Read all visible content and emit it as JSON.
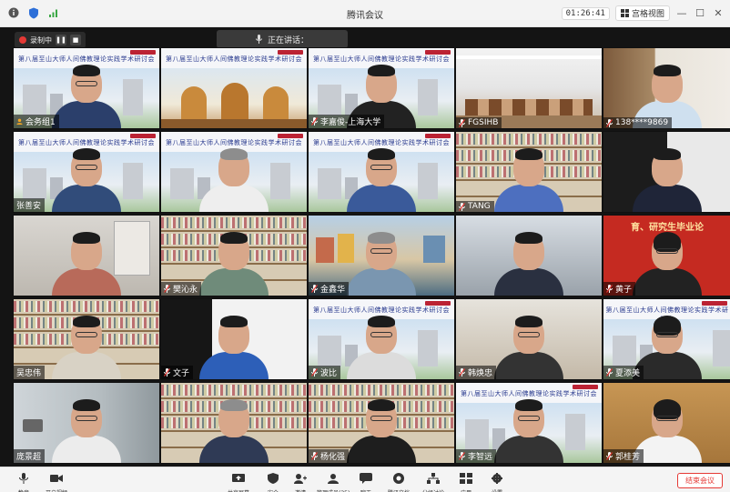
{
  "window": {
    "title": "腾讯会议",
    "timer": "01:26:41",
    "view_label": "宫格视图"
  },
  "recording": {
    "label": "录制中"
  },
  "speaking": {
    "label": "正在讲话："
  },
  "participants": [
    {
      "name": "会务组1",
      "icon": "user-host-icon"
    },
    {
      "name": "",
      "icon": ""
    },
    {
      "name": "李嘉俊-上海大学",
      "icon": "mic-muted-icon"
    },
    {
      "name": "FGSIHB",
      "icon": "mic-muted-icon"
    },
    {
      "name": "138****9869",
      "icon": "mic-muted-icon"
    },
    {
      "name": "张善安",
      "icon": ""
    },
    {
      "name": "",
      "icon": ""
    },
    {
      "name": "",
      "icon": ""
    },
    {
      "name": "TANG",
      "icon": "mic-muted-icon"
    },
    {
      "name": "",
      "icon": ""
    },
    {
      "name": "",
      "icon": ""
    },
    {
      "name": "樊沁永",
      "icon": "mic-muted-icon"
    },
    {
      "name": "金鑫华",
      "icon": "mic-muted-icon"
    },
    {
      "name": "",
      "icon": ""
    },
    {
      "name": "黄子",
      "icon": "mic-muted-icon"
    },
    {
      "name": "吴忠伟",
      "icon": ""
    },
    {
      "name": "文子",
      "icon": "mic-muted-icon"
    },
    {
      "name": "波比",
      "icon": "mic-muted-icon"
    },
    {
      "name": "韩焕忠",
      "icon": "mic-muted-icon"
    },
    {
      "name": "夏添美",
      "icon": "mic-muted-icon"
    },
    {
      "name": "庞景超",
      "icon": ""
    },
    {
      "name": "",
      "icon": ""
    },
    {
      "name": "杨化强",
      "icon": "mic-muted-icon"
    },
    {
      "name": "李智远",
      "icon": "mic-muted-icon"
    },
    {
      "name": "郭桂芳",
      "icon": "mic-muted-icon"
    }
  ],
  "banner_text": "第八届至山大师人间佛教理论实践学术研讨会",
  "secondary_banner": "育、研究生毕业论",
  "toolbar": {
    "items": [
      {
        "label": "静音",
        "icon": "microphone-icon"
      },
      {
        "label": "开启视频",
        "icon": "video-camera-icon"
      },
      {
        "label": "共享屏幕",
        "icon": "share-screen-icon"
      },
      {
        "label": "安全",
        "icon": "shield-icon"
      },
      {
        "label": "邀请",
        "icon": "invite-icon"
      },
      {
        "label": "管理成员(35)",
        "icon": "members-icon"
      },
      {
        "label": "聊天",
        "icon": "chat-icon"
      },
      {
        "label": "腾讯文档",
        "icon": "document-icon"
      },
      {
        "label": "分组讨论",
        "icon": "breakout-icon"
      },
      {
        "label": "应用",
        "icon": "apps-icon"
      },
      {
        "label": "设置",
        "icon": "gear-icon"
      }
    ],
    "leave_label": "结束会议"
  },
  "colors": {
    "recording": "#e53935",
    "leave": "#e53935",
    "stage": "#141414"
  }
}
